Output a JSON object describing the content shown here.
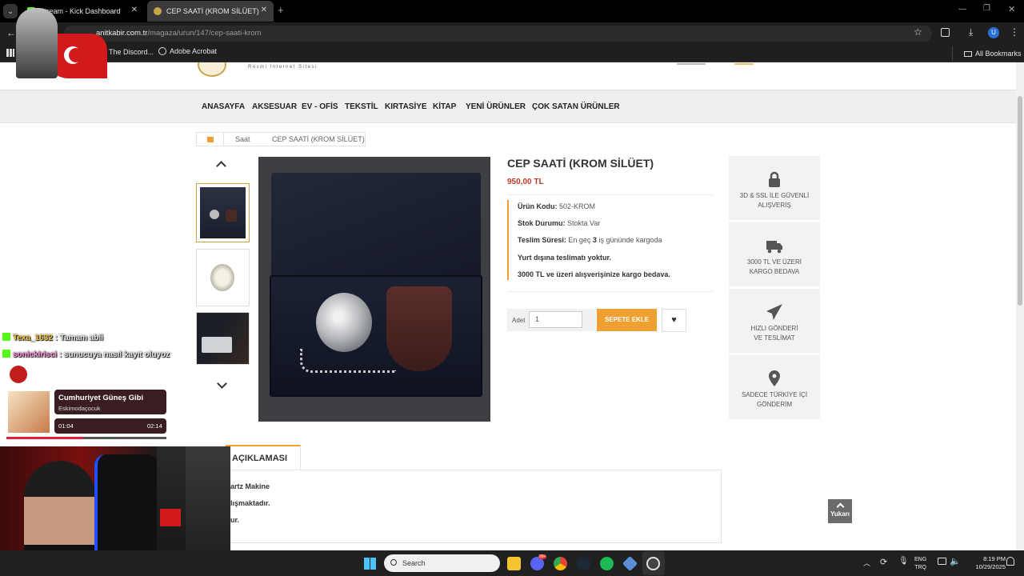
{
  "browser": {
    "tabs": [
      {
        "title": "Stream - Kick Dashboard"
      },
      {
        "title": "CEP SAATİ (KROM SİLÜET)"
      }
    ],
    "url_domain": "anitkabir.com.tr",
    "url_path": "/magaza/urun/147/cep-saati-krom",
    "bookmarks": [
      {
        "label": "The Discord..."
      },
      {
        "label": "Adobe Acrobat"
      }
    ],
    "all_bookmarks": "All Bookmarks",
    "profile_initial": "U"
  },
  "site": {
    "logo_subtitle": "Resmi İnternet Sitesi",
    "nav": [
      "ANASAYFA",
      "AKSESUAR",
      "EV - OFİS",
      "TEKSTİL",
      "KIRTASİYE",
      "KİTAP",
      "YENİ ÜRÜNLER",
      "ÇOK SATAN ÜRÜNLER"
    ],
    "breadcrumb": [
      "Saat",
      "CEP SAATİ (KROM SİLÜET)"
    ]
  },
  "product": {
    "title": "CEP SAATİ (KROM SİLÜET)",
    "price": "950,00 TL",
    "code_label": "Ürün Kodu:",
    "code_value": "502-KROM",
    "stock_label": "Stok Durumu:",
    "stock_value": "Stokta Var",
    "delivery_label": "Teslim Süresi:",
    "delivery_pre": "En geç",
    "delivery_days": "3",
    "delivery_post": "iş gününde kargoda",
    "note1": "Yurt dışına teslimatı yoktur.",
    "note2": "3000 TL ve üzeri alışverişinize kargo bedava.",
    "qty_label": "Adet",
    "qty_value": "1",
    "add_to_cart": "SEPETE EKLE"
  },
  "features": [
    {
      "icon": "lock-icon",
      "line1": "3D & SSL İLE GÜVENLİ",
      "line2": "ALIŞVERİŞ"
    },
    {
      "icon": "truck-icon",
      "line1": "3000 TL VE ÜZERİ",
      "line2": "KARGO BEDAVA"
    },
    {
      "icon": "paper-plane-icon",
      "line1": "HIZLI GÖNDERİ",
      "line2": "VE TESLİMAT"
    },
    {
      "icon": "map-marker-icon",
      "line1": "SADECE TÜRKİYE İÇİ",
      "line2": "GÖNDERİM"
    }
  ],
  "description": {
    "tab": "AÇIKLAMASI",
    "lines": [
      "artz Makine",
      "lışmaktadır.",
      "ur."
    ]
  },
  "back_to_top": "Yukarı",
  "overlay": {
    "chat": [
      {
        "user": "Texa_1632",
        "msg": ": Tamam abii"
      },
      {
        "user": "sonickirisci",
        "msg": ": sunucuya nasıl kayıt oluyoz"
      }
    ],
    "music": {
      "title": "Cumhuriyet Güneş Gibi",
      "artist": "Eskimodaçocuk",
      "elapsed": "01:04",
      "total": "02:14",
      "progress": 0.48
    }
  },
  "taskbar": {
    "search_placeholder": "Search",
    "lang1": "ENG",
    "lang2": "TRQ",
    "time": "8:19 PM",
    "date": "10/29/2025",
    "badge": "99+"
  },
  "colors": {
    "accent_orange": "#f0a030",
    "price_red": "#c0392b",
    "kick_green": "#53fc18"
  }
}
